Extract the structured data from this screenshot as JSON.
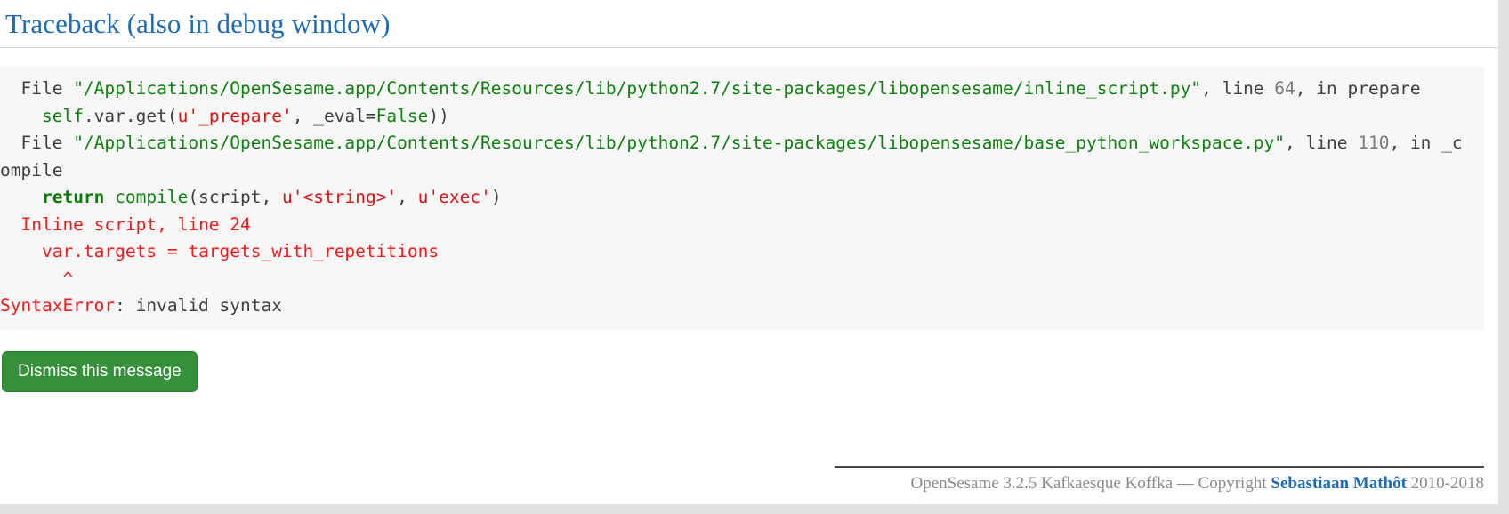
{
  "window": {
    "title": "Traceback (also in debug window)",
    "accent_blue": "#1f6cb4",
    "code_bg": "#f7f7f7",
    "button_green": "#35903a",
    "error_red": "#f21b1b",
    "string_green": "#108010"
  },
  "traceback": {
    "lines": [
      {
        "id": "line-1",
        "parts": [
          {
            "text": "  File ",
            "type": "plain"
          },
          {
            "text": "\"/Applications/OpenSesame.app/Contents/Resources/lib/python2.7/site-packages/libopensesame/inline_script.py\"",
            "type": "string"
          },
          {
            "text": ", line ",
            "type": "plain"
          },
          {
            "text": "64",
            "type": "number"
          },
          {
            "text": ", in prepare",
            "type": "plain"
          }
        ]
      },
      {
        "id": "line-2",
        "parts": [
          {
            "text": "    ",
            "type": "plain"
          },
          {
            "text": "self",
            "type": "name"
          },
          {
            "text": ".var.get(",
            "type": "plain"
          },
          {
            "text": "u'_prepare'",
            "type": "ustring"
          },
          {
            "text": ", _eval=",
            "type": "plain"
          },
          {
            "text": "False",
            "type": "name"
          },
          {
            "text": "))",
            "type": "plain"
          }
        ]
      },
      {
        "id": "line-3",
        "parts": [
          {
            "text": "  File ",
            "type": "plain"
          },
          {
            "text": "\"/Applications/OpenSesame.app/Contents/Resources/lib/python2.7/site-packages/libopensesame/base_python_workspace.py\"",
            "type": "string"
          },
          {
            "text": ", line ",
            "type": "plain"
          },
          {
            "text": "110",
            "type": "number"
          },
          {
            "text": ", in _compile",
            "type": "plain"
          }
        ]
      },
      {
        "id": "line-4",
        "parts": [
          {
            "text": "    ",
            "type": "plain"
          },
          {
            "text": "return",
            "type": "keyword"
          },
          {
            "text": " ",
            "type": "plain"
          },
          {
            "text": "compile",
            "type": "name"
          },
          {
            "text": "(script, ",
            "type": "plain"
          },
          {
            "text": "u'<string>'",
            "type": "ustring"
          },
          {
            "text": ", ",
            "type": "plain"
          },
          {
            "text": "u'exec'",
            "type": "ustring"
          },
          {
            "text": ")",
            "type": "plain"
          }
        ]
      },
      {
        "id": "line-5",
        "parts": [
          {
            "text": "  Inline script, line 24",
            "type": "error"
          }
        ]
      },
      {
        "id": "line-6",
        "parts": [
          {
            "text": "    var.targets = targets_with_repetitions",
            "type": "error"
          }
        ]
      },
      {
        "id": "line-7",
        "parts": [
          {
            "text": "      ^",
            "type": "error"
          }
        ]
      },
      {
        "id": "line-8",
        "parts": [
          {
            "text": "SyntaxError",
            "type": "errorname"
          },
          {
            "text": ": invalid syntax",
            "type": "plain"
          }
        ]
      }
    ]
  },
  "actions": {
    "dismiss_label": "Dismiss this message"
  },
  "footer": {
    "prefix": "OpenSesame 3.2.5 Kafkaesque Koffka — Copyright ",
    "link": "Sebastiaan Mathôt",
    "suffix": " 2010-2018"
  }
}
